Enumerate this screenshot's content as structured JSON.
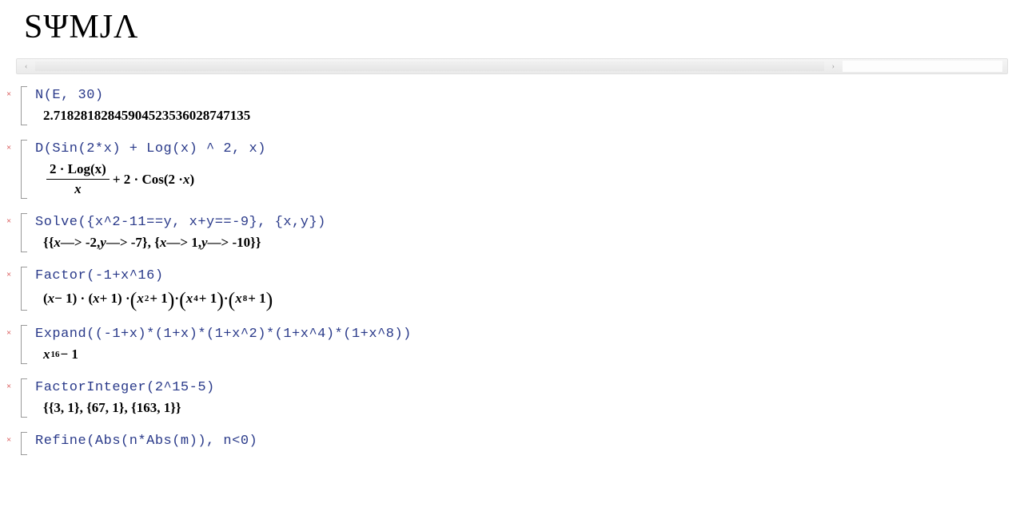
{
  "app": {
    "logo": "SΨMJΛ"
  },
  "toolbar": {
    "left_arrow": "‹",
    "right_arrow": "›"
  },
  "cells": [
    {
      "close": "×",
      "input": "N(E, 30)",
      "output_plain": "2.71828182845904523536028747135"
    },
    {
      "close": "×",
      "input": "D(Sin(2*x) + Log(x) ^ 2, x)",
      "output_math": {
        "frac_num": "2 · Log(x)",
        "frac_den_var": "x",
        "rest_pre": " + 2 · Cos(2 · ",
        "rest_var": "x",
        "rest_post": ")"
      }
    },
    {
      "close": "×",
      "input": "Solve({x^2-11==y, x+y==-9}, {x,y})",
      "output_solve": {
        "open": "{{",
        "x1": "x",
        "arrow1": " —> -2, ",
        "y1": "y",
        "arrow2": " —> -7}, {",
        "x2": "x",
        "arrow3": " —> 1, ",
        "y2": "y",
        "arrow4": " —> -10}}"
      }
    },
    {
      "close": "×",
      "input": "Factor(-1+x^16)",
      "output_factor": {
        "lp1": "(",
        "x1": "x",
        "m1": " − 1) · (",
        "x2": "x",
        "m2": " + 1) · ",
        "bl1": "(",
        "x3": "x",
        "e3": "2",
        "m3": " + 1",
        "br1": ")",
        "dot1": " · ",
        "bl2": "(",
        "x4": "x",
        "e4": "4",
        "m4": " + 1",
        "br2": ")",
        "dot2": " · ",
        "bl3": "(",
        "x5": "x",
        "e5": "8",
        "m5": " + 1",
        "br3": ")"
      }
    },
    {
      "close": "×",
      "input": "Expand((-1+x)*(1+x)*(1+x^2)*(1+x^4)*(1+x^8))",
      "output_expand": {
        "x": "x",
        "exp": "16",
        "rest": " − 1"
      }
    },
    {
      "close": "×",
      "input": "FactorInteger(2^15-5)",
      "output_plain": "{{3, 1}, {67, 1}, {163, 1}}"
    },
    {
      "close": "×",
      "input": "Refine(Abs(n*Abs(m)), n<0)"
    }
  ]
}
